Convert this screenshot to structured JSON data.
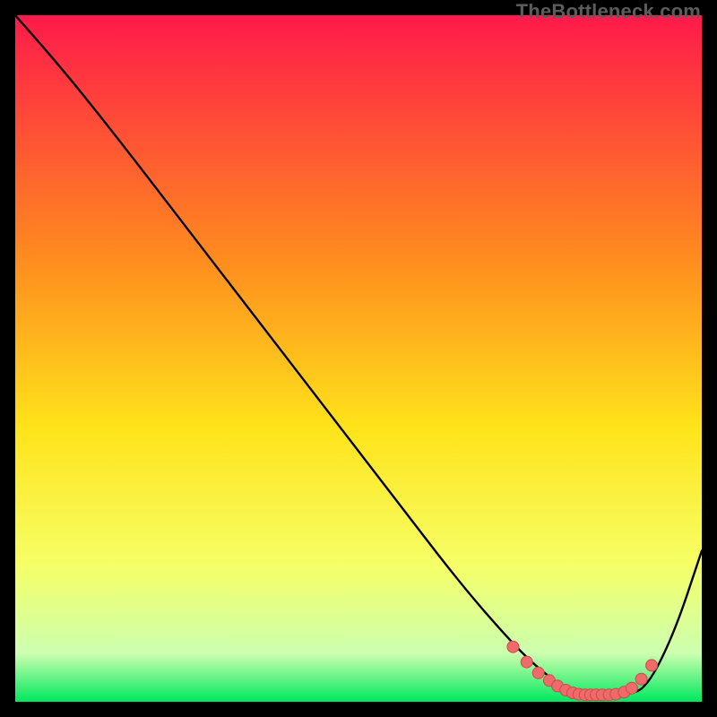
{
  "watermark": "TheBottleneck.com",
  "colors": {
    "gradient_top": "#ff1a4b",
    "gradient_mid1": "#ff8a1f",
    "gradient_mid2": "#ffe31a",
    "gradient_mid3": "#f6ff66",
    "gradient_mid4": "#ccffb0",
    "gradient_bottom": "#00e85e",
    "curve": "#000000",
    "markers_fill": "#ef6a6a",
    "markers_stroke": "#d14a4a"
  },
  "chart_data": {
    "type": "line",
    "title": "",
    "xlabel": "",
    "ylabel": "",
    "xlim": [
      0,
      100
    ],
    "ylim": [
      0,
      100
    ],
    "grid": false,
    "legend": false,
    "series": [
      {
        "name": "bottleneck-curve",
        "x": [
          0,
          7,
          15,
          25,
          35,
          45,
          55,
          65,
          72,
          76,
          80,
          83,
          86,
          89,
          92,
          96,
          100
        ],
        "y": [
          100,
          92,
          82,
          69,
          56,
          43,
          30,
          17,
          9,
          5,
          2,
          1,
          1,
          1,
          2,
          10,
          22
        ]
      }
    ],
    "markers": {
      "name": "highlight-dots",
      "x": [
        72.5,
        74.5,
        76.2,
        77.8,
        79.0,
        80.2,
        81.2,
        82.1,
        83.0,
        83.8,
        84.6,
        85.5,
        86.5,
        87.5,
        88.7,
        89.8,
        91.2,
        92.7
      ],
      "y": [
        8.0,
        5.8,
        4.2,
        3.1,
        2.3,
        1.7,
        1.3,
        1.1,
        1.0,
        1.0,
        1.0,
        1.0,
        1.0,
        1.1,
        1.4,
        2.0,
        3.3,
        5.3
      ]
    }
  }
}
